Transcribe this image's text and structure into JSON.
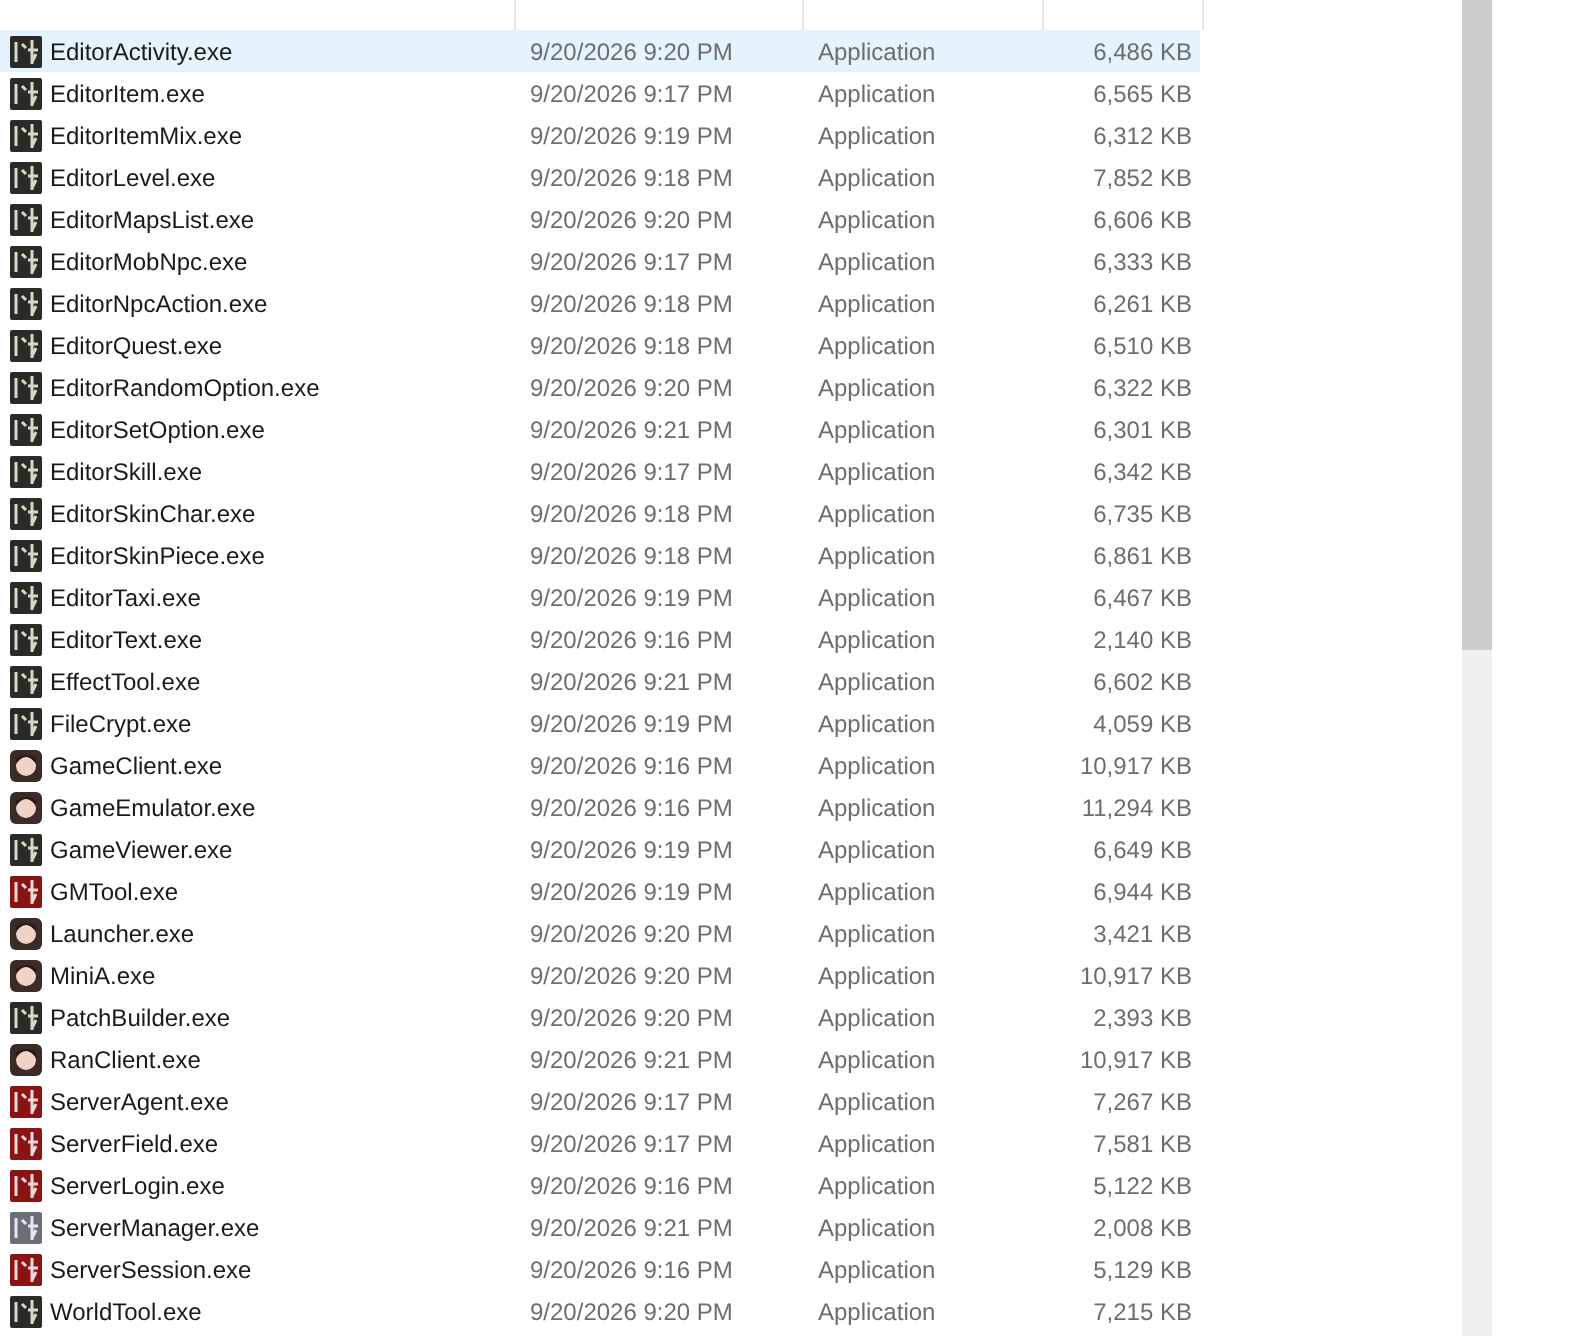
{
  "files": [
    {
      "name": "EditorActivity.exe",
      "date": "9/20/2026 9:20 PM",
      "type": "Application",
      "size": "6,486 KB",
      "kind": "dark",
      "selected": true
    },
    {
      "name": "EditorItem.exe",
      "date": "9/20/2026 9:17 PM",
      "type": "Application",
      "size": "6,565 KB",
      "kind": "dark",
      "selected": false
    },
    {
      "name": "EditorItemMix.exe",
      "date": "9/20/2026 9:19 PM",
      "type": "Application",
      "size": "6,312 KB",
      "kind": "dark",
      "selected": false
    },
    {
      "name": "EditorLevel.exe",
      "date": "9/20/2026 9:18 PM",
      "type": "Application",
      "size": "7,852 KB",
      "kind": "dark",
      "selected": false
    },
    {
      "name": "EditorMapsList.exe",
      "date": "9/20/2026 9:20 PM",
      "type": "Application",
      "size": "6,606 KB",
      "kind": "dark",
      "selected": false
    },
    {
      "name": "EditorMobNpc.exe",
      "date": "9/20/2026 9:17 PM",
      "type": "Application",
      "size": "6,333 KB",
      "kind": "dark",
      "selected": false
    },
    {
      "name": "EditorNpcAction.exe",
      "date": "9/20/2026 9:18 PM",
      "type": "Application",
      "size": "6,261 KB",
      "kind": "dark",
      "selected": false
    },
    {
      "name": "EditorQuest.exe",
      "date": "9/20/2026 9:18 PM",
      "type": "Application",
      "size": "6,510 KB",
      "kind": "dark",
      "selected": false
    },
    {
      "name": "EditorRandomOption.exe",
      "date": "9/20/2026 9:20 PM",
      "type": "Application",
      "size": "6,322 KB",
      "kind": "dark",
      "selected": false
    },
    {
      "name": "EditorSetOption.exe",
      "date": "9/20/2026 9:21 PM",
      "type": "Application",
      "size": "6,301 KB",
      "kind": "dark",
      "selected": false
    },
    {
      "name": "EditorSkill.exe",
      "date": "9/20/2026 9:17 PM",
      "type": "Application",
      "size": "6,342 KB",
      "kind": "dark",
      "selected": false
    },
    {
      "name": "EditorSkinChar.exe",
      "date": "9/20/2026 9:18 PM",
      "type": "Application",
      "size": "6,735 KB",
      "kind": "dark",
      "selected": false
    },
    {
      "name": "EditorSkinPiece.exe",
      "date": "9/20/2026 9:18 PM",
      "type": "Application",
      "size": "6,861 KB",
      "kind": "dark",
      "selected": false
    },
    {
      "name": "EditorTaxi.exe",
      "date": "9/20/2026 9:19 PM",
      "type": "Application",
      "size": "6,467 KB",
      "kind": "dark",
      "selected": false
    },
    {
      "name": "EditorText.exe",
      "date": "9/20/2026 9:16 PM",
      "type": "Application",
      "size": "2,140 KB",
      "kind": "dark",
      "selected": false
    },
    {
      "name": "EffectTool.exe",
      "date": "9/20/2026 9:21 PM",
      "type": "Application",
      "size": "6,602 KB",
      "kind": "dark",
      "selected": false
    },
    {
      "name": "FileCrypt.exe",
      "date": "9/20/2026 9:19 PM",
      "type": "Application",
      "size": "4,059 KB",
      "kind": "dark",
      "selected": false
    },
    {
      "name": "GameClient.exe",
      "date": "9/20/2026 9:16 PM",
      "type": "Application",
      "size": "10,917 KB",
      "kind": "portrait",
      "selected": false
    },
    {
      "name": "GameEmulator.exe",
      "date": "9/20/2026 9:16 PM",
      "type": "Application",
      "size": "11,294 KB",
      "kind": "portrait",
      "selected": false
    },
    {
      "name": "GameViewer.exe",
      "date": "9/20/2026 9:19 PM",
      "type": "Application",
      "size": "6,649 KB",
      "kind": "dark",
      "selected": false
    },
    {
      "name": "GMTool.exe",
      "date": "9/20/2026 9:19 PM",
      "type": "Application",
      "size": "6,944 KB",
      "kind": "red",
      "selected": false
    },
    {
      "name": "Launcher.exe",
      "date": "9/20/2026 9:20 PM",
      "type": "Application",
      "size": "3,421 KB",
      "kind": "portrait",
      "selected": false
    },
    {
      "name": "MiniA.exe",
      "date": "9/20/2026 9:20 PM",
      "type": "Application",
      "size": "10,917 KB",
      "kind": "portrait",
      "selected": false
    },
    {
      "name": "PatchBuilder.exe",
      "date": "9/20/2026 9:20 PM",
      "type": "Application",
      "size": "2,393 KB",
      "kind": "dark",
      "selected": false
    },
    {
      "name": "RanClient.exe",
      "date": "9/20/2026 9:21 PM",
      "type": "Application",
      "size": "10,917 KB",
      "kind": "portrait",
      "selected": false
    },
    {
      "name": "ServerAgent.exe",
      "date": "9/20/2026 9:17 PM",
      "type": "Application",
      "size": "7,267 KB",
      "kind": "red",
      "selected": false
    },
    {
      "name": "ServerField.exe",
      "date": "9/20/2026 9:17 PM",
      "type": "Application",
      "size": "7,581 KB",
      "kind": "red",
      "selected": false
    },
    {
      "name": "ServerLogin.exe",
      "date": "9/20/2026 9:16 PM",
      "type": "Application",
      "size": "5,122 KB",
      "kind": "red",
      "selected": false
    },
    {
      "name": "ServerManager.exe",
      "date": "9/20/2026 9:21 PM",
      "type": "Application",
      "size": "2,008 KB",
      "kind": "grey",
      "selected": false
    },
    {
      "name": "ServerSession.exe",
      "date": "9/20/2026 9:16 PM",
      "type": "Application",
      "size": "5,129 KB",
      "kind": "red",
      "selected": false
    },
    {
      "name": "WorldTool.exe",
      "date": "9/20/2026 9:20 PM",
      "type": "Application",
      "size": "7,215 KB",
      "kind": "dark",
      "selected": false
    }
  ]
}
